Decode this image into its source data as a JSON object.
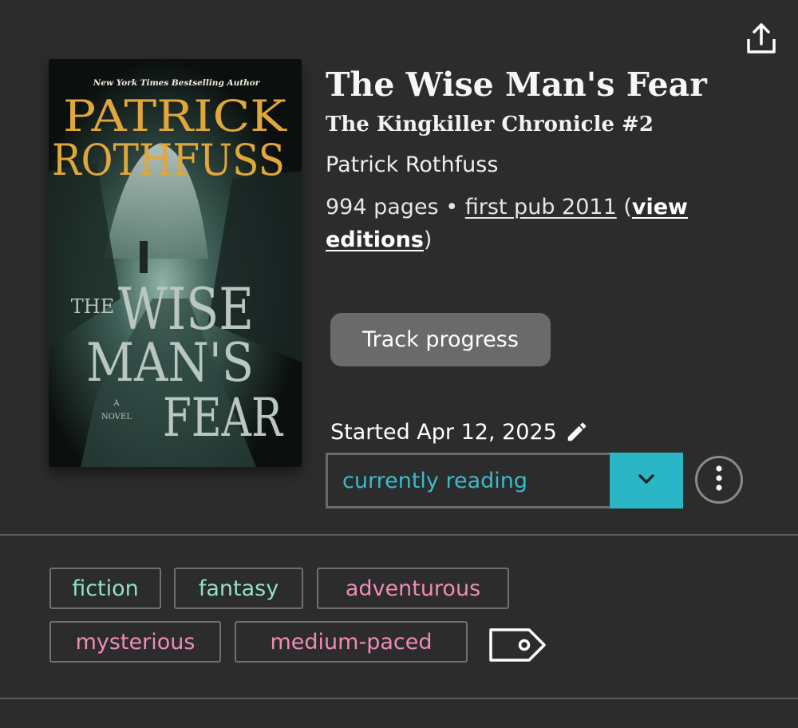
{
  "icons": {
    "share": "share-icon",
    "edit": "pencil-icon",
    "dropdown": "chevron-down-icon",
    "more": "more-vertical-icon",
    "add_tag": "tag-icon"
  },
  "cover": {
    "tagline": "New York Times Bestselling Author",
    "author_line1": "PATRICK",
    "author_line2": "ROTHFUSS",
    "title_the": "THE",
    "title_wise": "WISE",
    "title_mans": "MAN'S",
    "title_fear": "FEAR",
    "novel_a": "A",
    "novel_word": "NOVEL"
  },
  "book": {
    "title": "The Wise Man's Fear",
    "series": "The Kingkiller Chronicle #2",
    "author": "Patrick Rothfuss",
    "pages": "994 pages",
    "separator": " • ",
    "first_pub": "first pub 2011",
    "paren_open": " (",
    "view_editions": "view editions",
    "paren_close": ")"
  },
  "actions": {
    "track_progress": "Track progress",
    "started_label": "Started Apr 12, 2025",
    "status": "currently reading"
  },
  "tags": [
    {
      "label": "fiction",
      "color": "#8fe3c0"
    },
    {
      "label": "fantasy",
      "color": "#8fe3c0"
    },
    {
      "label": "adventurous",
      "color": "#f08bb8"
    },
    {
      "label": "mysterious",
      "color": "#f08bb8"
    },
    {
      "label": "medium-paced",
      "color": "#f08bb8"
    }
  ],
  "colors": {
    "background": "#2c2c2c",
    "accent": "#2bb6c6",
    "status_text": "#3dbac8",
    "button_bg": "#6a6a6a"
  }
}
